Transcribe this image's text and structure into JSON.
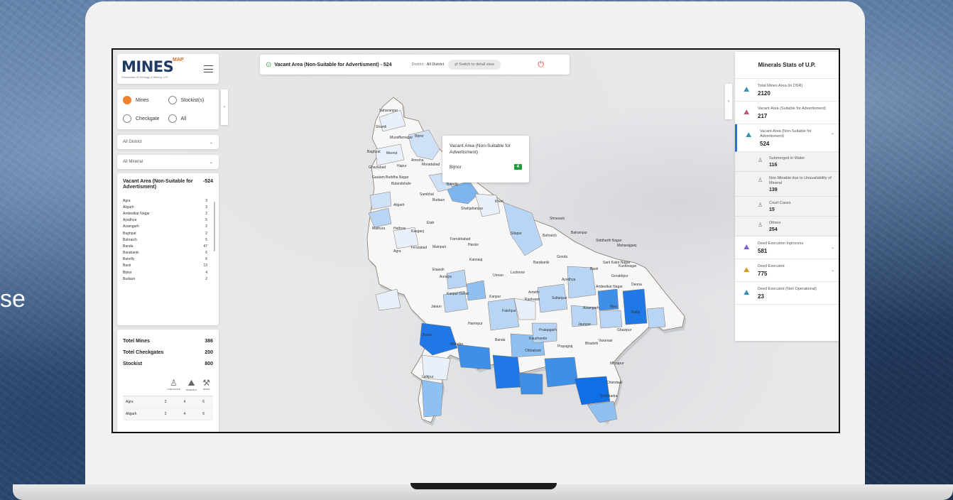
{
  "background": {
    "side_text": "se"
  },
  "left_panel": {
    "logo_text": "MINES",
    "logo_tag": "MAP",
    "logo_sub": "Directorate of Geology & Mining, U.P.",
    "radios": [
      {
        "label": "Mines",
        "selected": true
      },
      {
        "label": "Stockist(s)",
        "selected": false
      },
      {
        "label": "Checkgate",
        "selected": false
      },
      {
        "label": "All",
        "selected": false
      }
    ],
    "district_select": "All District",
    "mineral_select": "All Mineral",
    "list_title": "Vacant Area (Non-Suitable for Advertisment)",
    "list_total": "-524",
    "list_rows": [
      {
        "name": "Agra",
        "value": "3"
      },
      {
        "name": "Aligarh",
        "value": "3"
      },
      {
        "name": "Ambedkar Nagar",
        "value": "2"
      },
      {
        "name": "Ayodhya",
        "value": "5"
      },
      {
        "name": "Azamgarh",
        "value": "2"
      },
      {
        "name": "Baghpat",
        "value": "2"
      },
      {
        "name": "Bahraich",
        "value": "5"
      },
      {
        "name": "Banda",
        "value": "47"
      },
      {
        "name": "Barabanki",
        "value": "6"
      },
      {
        "name": "Bareilly",
        "value": "6"
      },
      {
        "name": "Basti",
        "value": "13"
      },
      {
        "name": "Bijnor",
        "value": "4"
      },
      {
        "name": "Budaun",
        "value": "2"
      }
    ],
    "totals": [
      {
        "label": "Totel Mines",
        "value": "386"
      },
      {
        "label": "Totel Checkgates",
        "value": "200"
      },
      {
        "label": "Stockist",
        "value": "800"
      }
    ],
    "icon_labels": [
      "CHECKGATE",
      "MINERALS",
      "MINES"
    ],
    "table_rows": [
      {
        "name": "Agra",
        "c1": "2",
        "c2": "4",
        "c3": "6"
      },
      {
        "name": "Aligarh",
        "c1": "2",
        "c2": "4",
        "c3": "6"
      }
    ]
  },
  "topbar": {
    "title": "Vacant Area (Non-Suitable for Advertisment) - 524",
    "district_label": "District :",
    "district_value": "All District",
    "switch_label": "⇄ Switch to detail view"
  },
  "tooltip": {
    "title": "Vacant Area (Non-Suitable for Advertisment)",
    "district": "Bijnor",
    "value": "4"
  },
  "right_panel": {
    "title": "Minerals Stats of U.P.",
    "items": [
      {
        "label": "Total Mines Area (in DSR)",
        "value": "2120"
      },
      {
        "label": "Vacant Area (Suitable for Advertisment)",
        "value": "217"
      },
      {
        "label": "Vacant Area (Non-Suitable for Advertisment)",
        "value": "524"
      }
    ],
    "sub_items": [
      {
        "label": "Submerged in Water",
        "value": "116"
      },
      {
        "label": "Non Minable due to Unavailability of Mineral",
        "value": "139"
      },
      {
        "label": "Court Cases",
        "value": "15"
      },
      {
        "label": "Others",
        "value": "254"
      }
    ],
    "items_after": [
      {
        "label": "Deed Execution Inprocess",
        "value": "581"
      },
      {
        "label": "Deed Executed",
        "value": "775"
      },
      {
        "label": "Deed Executed (Non Operational)",
        "value": "23"
      }
    ]
  },
  "map_labels": [
    "Saharanpur",
    "Shamli",
    "Muzaffarnagar",
    "Bijnor",
    "Baghpat",
    "Meerut",
    "Amroha",
    "Ghaziabad",
    "Hapur",
    "Moradabad",
    "Gautam Buddha Nagar",
    "Bulandshahr",
    "Sambhal",
    "Bareilly",
    "Aligarh",
    "Budaun",
    "Shahjahanpur",
    "Kheri",
    "Shravasti",
    "Mathura",
    "Hathras",
    "Kasganj",
    "Etah",
    "Sitapur",
    "Bahraich",
    "Balrampur",
    "Siddharth Nagar",
    "Maharajganj",
    "Agra",
    "Firozabad",
    "Mainpuri",
    "Farrukhabad",
    "Hardoi",
    "Gonda",
    "Sant Kabir Nagar",
    "Kushinagar",
    "Etawah",
    "Kannauj",
    "Barabanki",
    "Basti",
    "Gorakhpur",
    "Deoria",
    "Auraiya",
    "Unnao",
    "Lucknow",
    "Ayodhya",
    "Ambedkar Nagar",
    "Kanpur Dehat",
    "Kanpur",
    "Raebareli",
    "Amethi",
    "Sultanpur",
    "Azamgarh",
    "Mau",
    "Ballia",
    "Jalaun",
    "Hamirpur",
    "Fatehpur",
    "Pratapgarh",
    "Jaunpur",
    "Ghazipur",
    "Jhansi",
    "Mahoba",
    "Banda",
    "Kaushambi",
    "Chitrakoot",
    "Prayagraj",
    "Bhadohi",
    "Varanasi",
    "Mirzapur",
    "Chandauli",
    "Lalitpur",
    "Sonbhadra"
  ]
}
